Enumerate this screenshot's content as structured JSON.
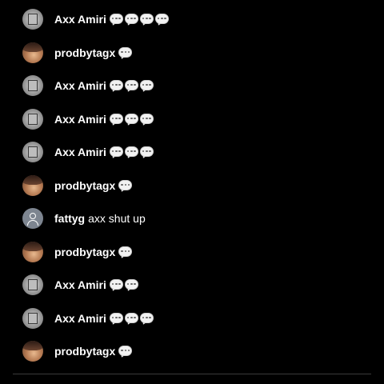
{
  "messages": [
    {
      "author": "Axx Amiri",
      "avatar": "gray-photo-avatar",
      "text": "",
      "bubble_count": 4
    },
    {
      "author": "prodbytagx",
      "avatar": "warm-photo-avatar",
      "text": "",
      "bubble_count": 1
    },
    {
      "author": "Axx Amiri",
      "avatar": "gray-photo-avatar",
      "text": "",
      "bubble_count": 3
    },
    {
      "author": "Axx Amiri",
      "avatar": "gray-photo-avatar",
      "text": "",
      "bubble_count": 3
    },
    {
      "author": "Axx Amiri",
      "avatar": "gray-photo-avatar",
      "text": "",
      "bubble_count": 3
    },
    {
      "author": "prodbytagx",
      "avatar": "warm-photo-avatar",
      "text": "",
      "bubble_count": 1
    },
    {
      "author": "fattyg",
      "avatar": "default-user-icon",
      "text": "axx shut up",
      "bubble_count": 0
    },
    {
      "author": "prodbytagx",
      "avatar": "warm-photo-avatar",
      "text": "",
      "bubble_count": 1
    },
    {
      "author": "Axx Amiri",
      "avatar": "gray-photo-avatar",
      "text": "",
      "bubble_count": 2
    },
    {
      "author": "Axx Amiri",
      "avatar": "gray-photo-avatar",
      "text": "",
      "bubble_count": 3
    },
    {
      "author": "prodbytagx",
      "avatar": "warm-photo-avatar",
      "text": "",
      "bubble_count": 1
    }
  ],
  "emoji": "speech-bubble-icon",
  "colors": {
    "background": "#000000",
    "text": "#ffffff",
    "bubble": "#f2f2f2",
    "default_avatar": "#7d8590"
  }
}
